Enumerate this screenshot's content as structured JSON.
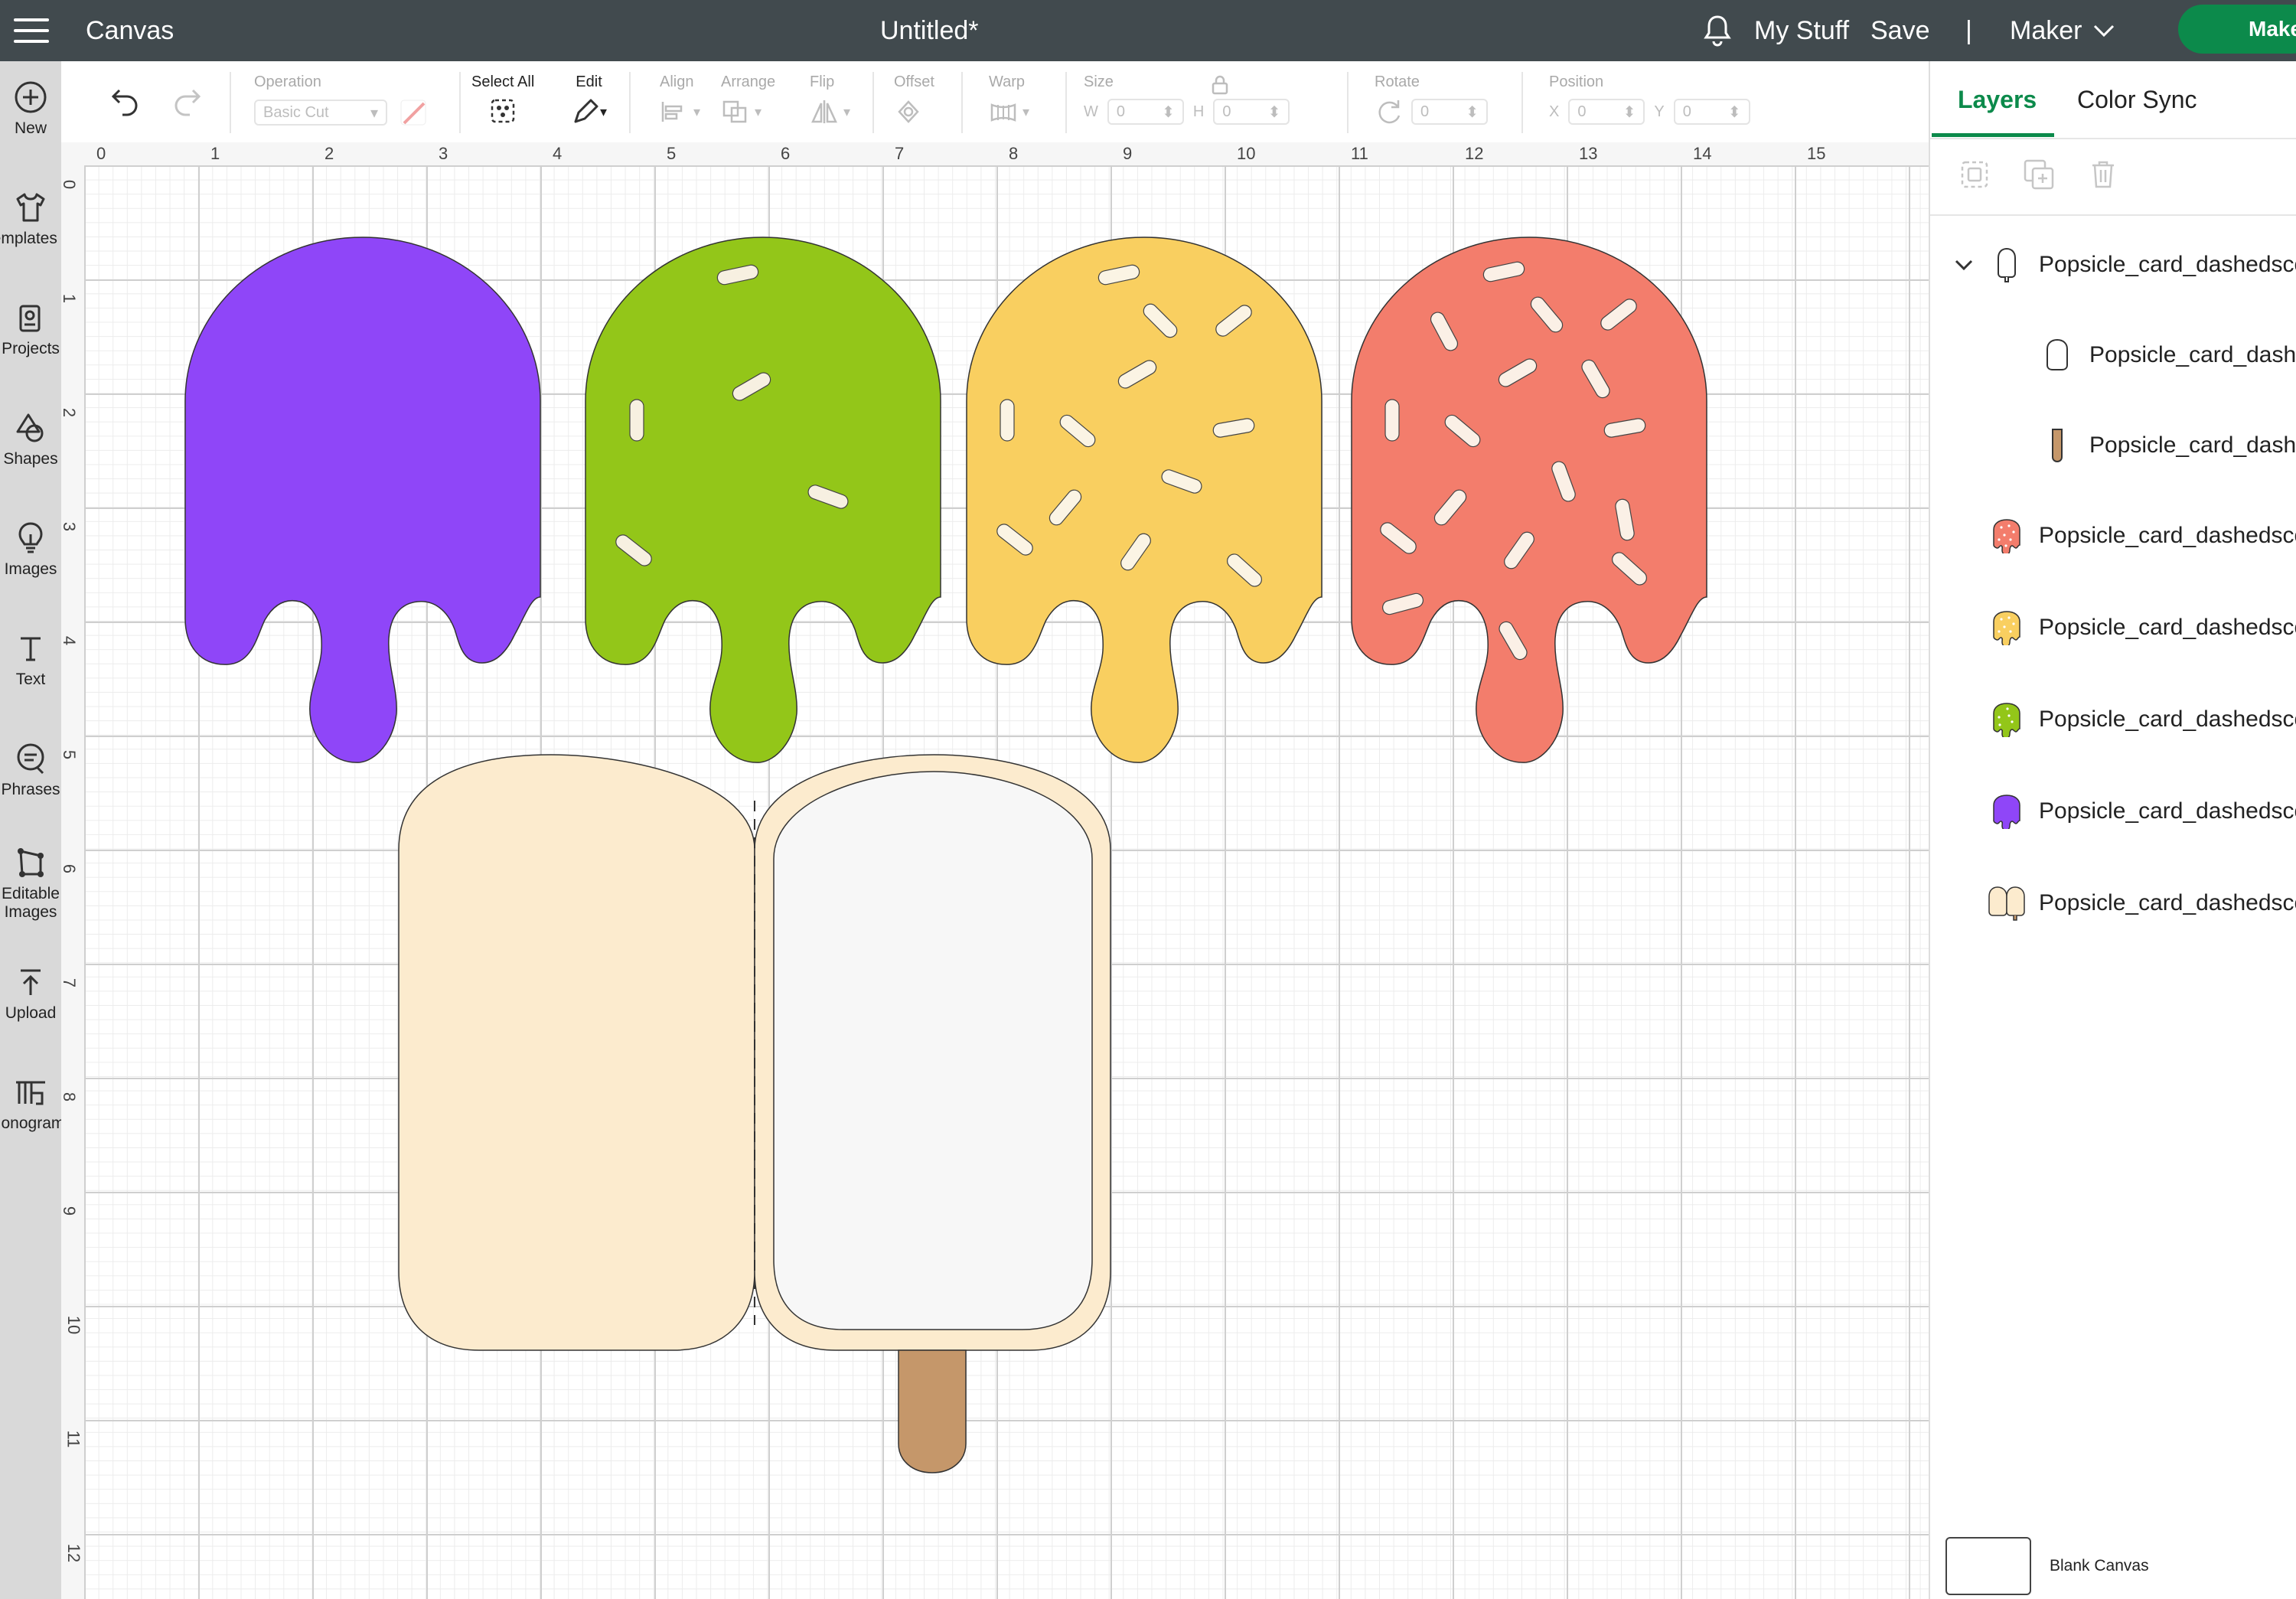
{
  "topbar": {
    "app_title": "Canvas",
    "doc_title": "Untitled*",
    "my_stuff": "My Stuff",
    "save": "Save",
    "separator": "|",
    "machine": "Maker",
    "make": "Make"
  },
  "leftbar": {
    "items": [
      {
        "label": "New",
        "icon": "plus-circle-icon"
      },
      {
        "label": "Templates",
        "icon": "shirt-icon"
      },
      {
        "label": "Projects",
        "icon": "projects-icon"
      },
      {
        "label": "Shapes",
        "icon": "shapes-icon"
      },
      {
        "label": "Images",
        "icon": "bulb-icon"
      },
      {
        "label": "Text",
        "icon": "text-icon"
      },
      {
        "label": "Phrases",
        "icon": "phrases-icon"
      },
      {
        "label": "Editable",
        "label2": "Images",
        "icon": "editable-icon"
      },
      {
        "label": "Upload",
        "icon": "upload-icon"
      },
      {
        "label": "Monogram",
        "icon": "monogram-icon"
      }
    ]
  },
  "toolbar": {
    "operation_label": "Operation",
    "operation_value": "Basic Cut",
    "select_all_label": "Select All",
    "edit_label": "Edit",
    "align_label": "Align",
    "arrange_label": "Arrange",
    "flip_label": "Flip",
    "offset_label": "Offset",
    "warp_label": "Warp",
    "size_label": "Size",
    "size_w": "W",
    "size_h": "H",
    "size_w_value": "0",
    "size_h_value": "0",
    "rotate_label": "Rotate",
    "rotate_value": "0",
    "position_label": "Position",
    "position_x": "X",
    "position_y": "Y",
    "position_x_value": "0",
    "position_y_value": "0"
  },
  "ruler": {
    "x_ticks": [
      "0",
      "1",
      "2",
      "3",
      "4",
      "5",
      "6",
      "7",
      "8",
      "9",
      "10",
      "11",
      "12",
      "13",
      "14",
      "15"
    ],
    "y_ticks": [
      "0",
      "1",
      "2",
      "3",
      "4",
      "5",
      "6",
      "7",
      "8",
      "9",
      "10",
      "11",
      "12"
    ]
  },
  "colors": {
    "purple": "#8f46f8",
    "green": "#93c619",
    "yellow": "#f9cf60",
    "coral": "#f37d6c",
    "cream": "#fcebce",
    "white_inset": "#f7f7f7",
    "stick": "#c5976a",
    "accent": "#0c8a4b",
    "topbar": "#414a4e"
  },
  "layers": {
    "tab_layers": "Layers",
    "tab_color_sync": "Color Sync",
    "items": [
      {
        "name": "Popsicle_card_dashedscore",
        "thumb": "outline",
        "level": 0,
        "expanded": true
      },
      {
        "name": "Popsicle_card_dashedscore",
        "thumb": "white-rounded",
        "level": 1
      },
      {
        "name": "Popsicle_card_dashedscore",
        "thumb": "stick",
        "level": 1
      },
      {
        "name": "Popsicle_card_dashedscore",
        "thumb": "coral-drip",
        "level": 0
      },
      {
        "name": "Popsicle_card_dashedscore",
        "thumb": "yellow-drip",
        "level": 0
      },
      {
        "name": "Popsicle_card_dashedscore",
        "thumb": "green-drip",
        "level": 0
      },
      {
        "name": "Popsicle_card_dashedscore",
        "thumb": "purple-drip",
        "level": 0
      },
      {
        "name": "Popsicle_card_dashedscore",
        "thumb": "cream-card",
        "level": 0
      }
    ],
    "blank_canvas_label": "Blank Canvas"
  }
}
